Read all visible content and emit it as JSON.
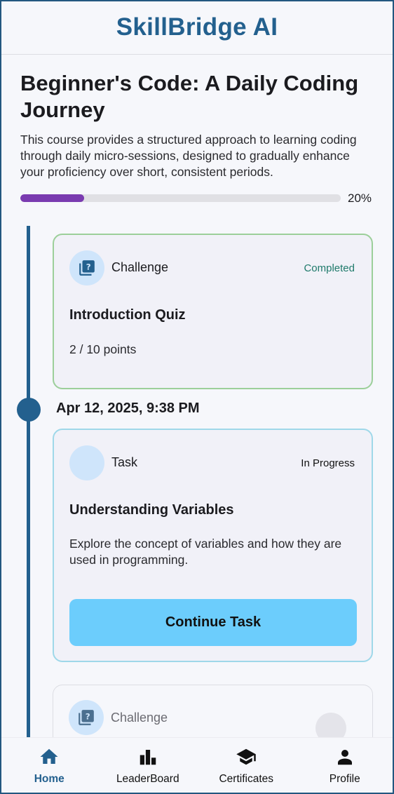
{
  "app": {
    "title": "SkillBridge AI"
  },
  "course": {
    "title": "Beginner's Code: A Daily Coding Journey",
    "description": "This course provides a structured approach to learning coding through daily micro-sessions, designed to gradually enhance your proficiency over short, consistent periods.",
    "progress_fraction": 0.2,
    "progress_label": "20%"
  },
  "timeline": {
    "date": "Apr 12, 2025, 9:38 PM",
    "cards": [
      {
        "type_label": "Challenge",
        "icon": "quiz-icon",
        "status": "Completed",
        "status_color": "#1f7a6b",
        "title": "Introduction Quiz",
        "body": "2 / 10 points"
      },
      {
        "type_label": "Task",
        "icon": "task-icon",
        "status": "In Progress",
        "status_color": "#111111",
        "title": "Understanding Variables",
        "body": "Explore the concept of variables and how they are used in programming.",
        "button_label": "Continue Task"
      },
      {
        "type_label": "Challenge",
        "icon": "quiz-icon"
      }
    ]
  },
  "nav": {
    "items": [
      {
        "label": "Home",
        "icon": "home-icon",
        "active": true
      },
      {
        "label": "LeaderBoard",
        "icon": "leaderboard-icon"
      },
      {
        "label": "Certificates",
        "icon": "graduation-cap-icon"
      },
      {
        "label": "Profile",
        "icon": "person-icon"
      }
    ]
  },
  "colors": {
    "brand": "#23608e",
    "progress": "#7a3bb0",
    "cta": "#6ccdfc",
    "completed_border": "#9ccf9a",
    "inprogress_border": "#9fd8e9"
  }
}
